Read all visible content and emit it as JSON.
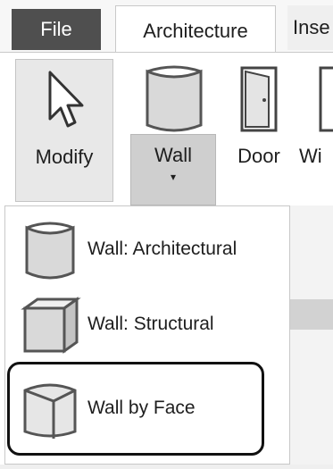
{
  "tabs": {
    "file": "File",
    "architecture": "Architecture",
    "insert_partial": "Inse"
  },
  "ribbon": {
    "modify": "Modify",
    "wall": "Wall",
    "wall_arrow": "▾",
    "door": "Door",
    "window_partial": "Wi"
  },
  "wall_menu": {
    "items": [
      {
        "label": "Wall: Architectural",
        "icon": "wall-architectural-icon"
      },
      {
        "label": "Wall: Structural",
        "icon": "wall-structural-icon"
      },
      {
        "label": "Wall by Face",
        "icon": "wall-by-face-icon",
        "highlighted": true
      }
    ]
  }
}
